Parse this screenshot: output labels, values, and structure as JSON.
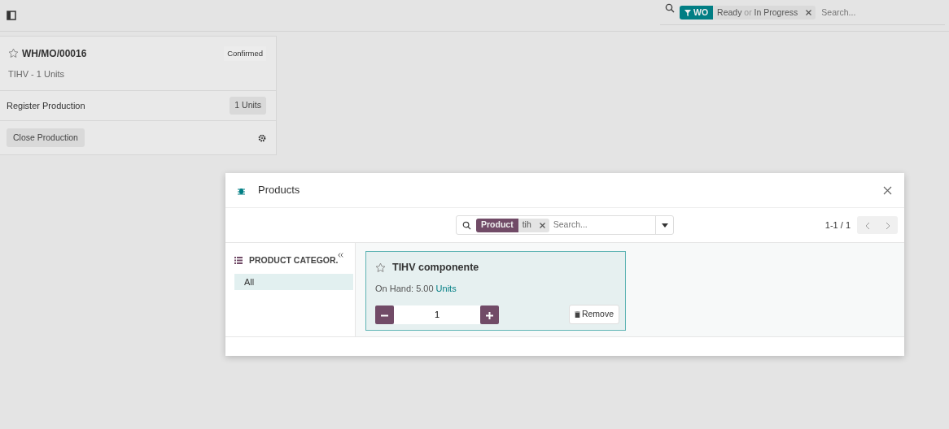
{
  "facet_rows": [
    [
      {
        "kind": "filter",
        "label": "WO",
        "values": [
          "Ready",
          "In Progress"
        ],
        "color": "#017e84"
      }
    ]
  ],
  "facet_separator": "or",
  "search_placeholder": "Search...",
  "mo_card": {
    "title": "WH/MO/00016",
    "starred": false,
    "status": "Confirmed",
    "subtitle": "TIHV - 1 Units",
    "register_label": "Register Production",
    "register_qty": "1 Units",
    "close_button": "Close Production"
  },
  "dialog": {
    "title": "Products",
    "search": {
      "facet_label": "Product",
      "facet_value": "tih",
      "placeholder": "Search..."
    },
    "pager": "1-1 / 1",
    "sidebar": {
      "title": "PRODUCT CATEGOR.",
      "items": [
        {
          "label": "All",
          "selected": true
        }
      ]
    },
    "products": [
      {
        "name": "TIHV componente",
        "starred": false,
        "on_hand": "On Hand: 5.00",
        "unit": "Units",
        "quantity": "1",
        "selected": true,
        "remove": "Remove"
      }
    ]
  }
}
